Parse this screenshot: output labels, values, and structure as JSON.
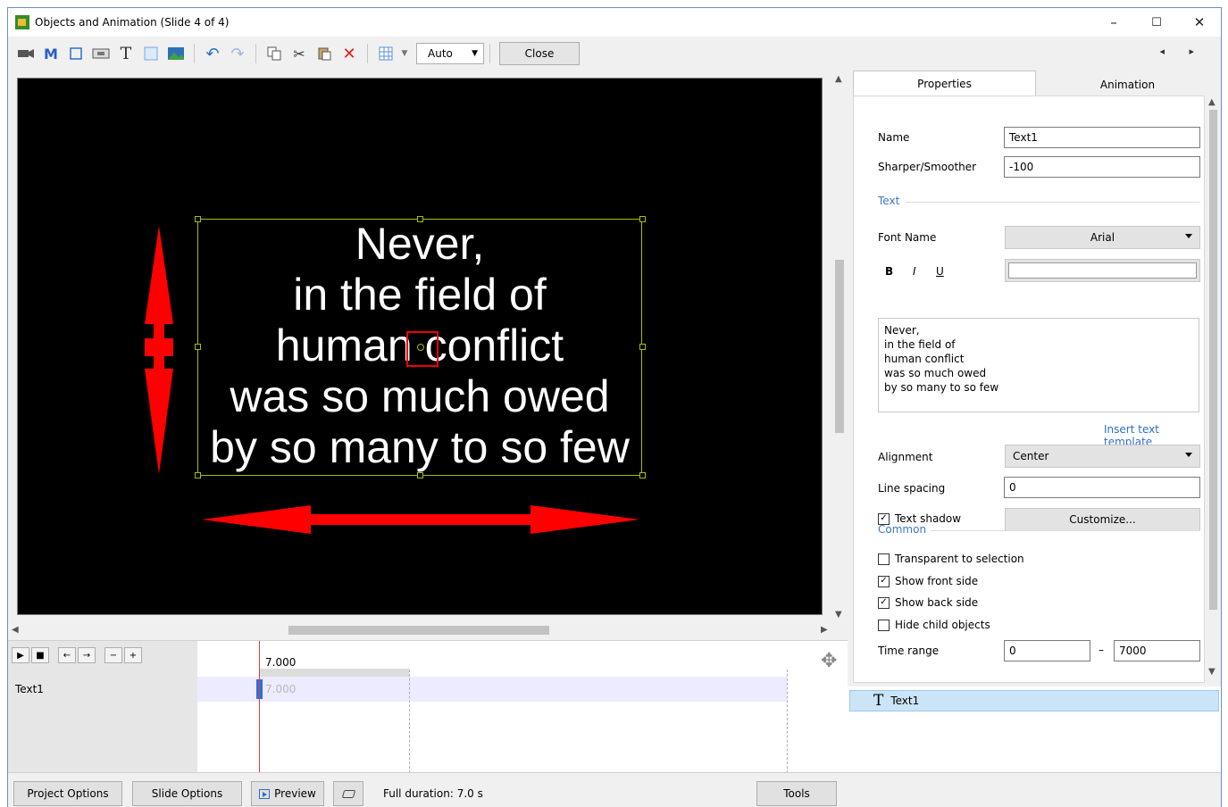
{
  "window": {
    "title": "Objects and Animation (Slide 4 of 4)",
    "controls": {
      "minimize": "–",
      "maximize": "☐",
      "close": "✕"
    }
  },
  "toolbar": {
    "icons": [
      "camera-icon",
      "mask-icon",
      "frame-icon",
      "button-icon",
      "text-icon",
      "rectangle-icon",
      "image-icon",
      "undo-icon",
      "redo-icon",
      "copy-icon",
      "cut-icon",
      "paste-icon",
      "delete-icon",
      "grid-icon"
    ],
    "text_tool": "T",
    "mask_tool": "M",
    "zoom_select": "Auto",
    "close_label": "Close",
    "nav": "◂ ▸"
  },
  "stage": {
    "text": "Never,\nin the field of\nhuman conflict\nwas so much owed\nby so many to so few",
    "arrow_color": "#ff0000",
    "selection_color": "#a5bf00"
  },
  "timeline": {
    "time_label": "7.000",
    "row_time": "7.000",
    "row_label": "Text1",
    "buttons": [
      "▶",
      "■",
      "←",
      "→",
      "−",
      "+"
    ]
  },
  "panel": {
    "tabs": [
      {
        "label": "Properties",
        "active": true
      },
      {
        "label": "Animation",
        "active": false
      }
    ],
    "name_label": "Name",
    "name_value": "Text1",
    "sharper_label": "Sharper/Smoother",
    "sharper_value": "-100",
    "text_section": "Text",
    "font_label": "Font Name",
    "font_value": "Arial",
    "bold": "B",
    "italic": "I",
    "underline": "U",
    "text_content": "Never,\n in the field of\nhuman conflict\nwas so much owed\n by so many to so few",
    "insert_template": "Insert text template",
    "alignment_label": "Alignment",
    "alignment_value": "Center",
    "line_spacing_label": "Line spacing",
    "line_spacing_value": "0",
    "text_shadow_label": "Text shadow",
    "text_shadow_checked": true,
    "customize_label": "Customize...",
    "common_section": "Common",
    "transparent_label": "Transparent to selection",
    "show_front_label": "Show front side",
    "show_back_label": "Show back side",
    "hide_child_label": "Hide child objects",
    "time_range_label": "Time range",
    "time_range_from": "0",
    "time_range_dash": "–",
    "time_range_to": "7000",
    "object_list": [
      {
        "icon": "T",
        "label": "Text1"
      }
    ]
  },
  "bottombar": {
    "project_options": "Project Options",
    "slide_options": "Slide Options",
    "preview": "Preview",
    "full_duration": "Full duration: 7.0 s",
    "tools": "Tools"
  }
}
